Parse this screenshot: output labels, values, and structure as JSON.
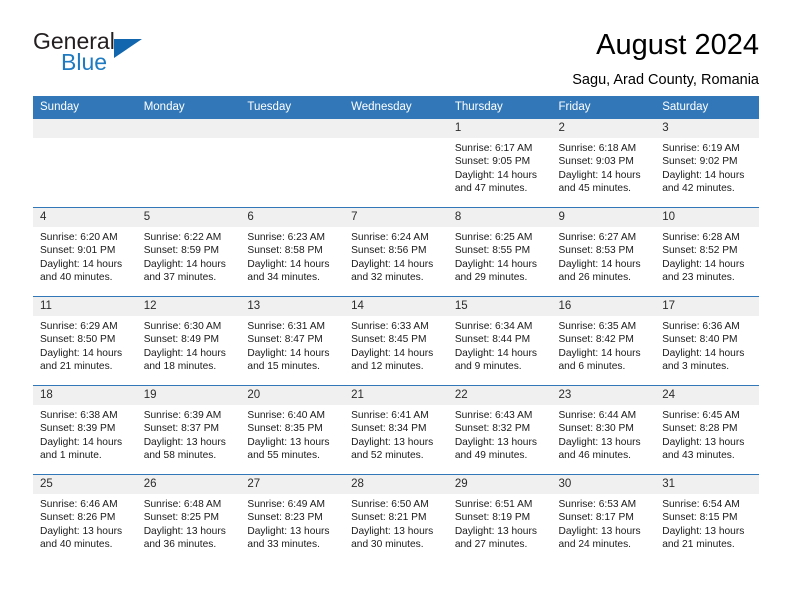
{
  "brand": {
    "name_top": "General",
    "name_bottom": "Blue",
    "accent_color": "#1266ad",
    "logo_text_color": "#231f20"
  },
  "header": {
    "title": "August 2024",
    "subtitle": "Sagu, Arad County, Romania"
  },
  "theme": {
    "header_row_bg": "#3278b9",
    "header_row_text": "#ffffff",
    "daynum_bg": "#f0f0f0"
  },
  "labels": {
    "sunrise_prefix": "Sunrise:",
    "sunset_prefix": "Sunset:",
    "daylight_prefix": "Daylight:"
  },
  "weekdays": [
    "Sunday",
    "Monday",
    "Tuesday",
    "Wednesday",
    "Thursday",
    "Friday",
    "Saturday"
  ],
  "weeks": [
    [
      {
        "day": "",
        "blank": true
      },
      {
        "day": "",
        "blank": true
      },
      {
        "day": "",
        "blank": true
      },
      {
        "day": "",
        "blank": true
      },
      {
        "day": "1",
        "sunrise": "Sunrise: 6:17 AM",
        "sunset": "Sunset: 9:05 PM",
        "daylight_1": "Daylight: 14 hours",
        "daylight_2": "and 47 minutes."
      },
      {
        "day": "2",
        "sunrise": "Sunrise: 6:18 AM",
        "sunset": "Sunset: 9:03 PM",
        "daylight_1": "Daylight: 14 hours",
        "daylight_2": "and 45 minutes."
      },
      {
        "day": "3",
        "sunrise": "Sunrise: 6:19 AM",
        "sunset": "Sunset: 9:02 PM",
        "daylight_1": "Daylight: 14 hours",
        "daylight_2": "and 42 minutes."
      }
    ],
    [
      {
        "day": "4",
        "sunrise": "Sunrise: 6:20 AM",
        "sunset": "Sunset: 9:01 PM",
        "daylight_1": "Daylight: 14 hours",
        "daylight_2": "and 40 minutes."
      },
      {
        "day": "5",
        "sunrise": "Sunrise: 6:22 AM",
        "sunset": "Sunset: 8:59 PM",
        "daylight_1": "Daylight: 14 hours",
        "daylight_2": "and 37 minutes."
      },
      {
        "day": "6",
        "sunrise": "Sunrise: 6:23 AM",
        "sunset": "Sunset: 8:58 PM",
        "daylight_1": "Daylight: 14 hours",
        "daylight_2": "and 34 minutes."
      },
      {
        "day": "7",
        "sunrise": "Sunrise: 6:24 AM",
        "sunset": "Sunset: 8:56 PM",
        "daylight_1": "Daylight: 14 hours",
        "daylight_2": "and 32 minutes."
      },
      {
        "day": "8",
        "sunrise": "Sunrise: 6:25 AM",
        "sunset": "Sunset: 8:55 PM",
        "daylight_1": "Daylight: 14 hours",
        "daylight_2": "and 29 minutes."
      },
      {
        "day": "9",
        "sunrise": "Sunrise: 6:27 AM",
        "sunset": "Sunset: 8:53 PM",
        "daylight_1": "Daylight: 14 hours",
        "daylight_2": "and 26 minutes."
      },
      {
        "day": "10",
        "sunrise": "Sunrise: 6:28 AM",
        "sunset": "Sunset: 8:52 PM",
        "daylight_1": "Daylight: 14 hours",
        "daylight_2": "and 23 minutes."
      }
    ],
    [
      {
        "day": "11",
        "sunrise": "Sunrise: 6:29 AM",
        "sunset": "Sunset: 8:50 PM",
        "daylight_1": "Daylight: 14 hours",
        "daylight_2": "and 21 minutes."
      },
      {
        "day": "12",
        "sunrise": "Sunrise: 6:30 AM",
        "sunset": "Sunset: 8:49 PM",
        "daylight_1": "Daylight: 14 hours",
        "daylight_2": "and 18 minutes."
      },
      {
        "day": "13",
        "sunrise": "Sunrise: 6:31 AM",
        "sunset": "Sunset: 8:47 PM",
        "daylight_1": "Daylight: 14 hours",
        "daylight_2": "and 15 minutes."
      },
      {
        "day": "14",
        "sunrise": "Sunrise: 6:33 AM",
        "sunset": "Sunset: 8:45 PM",
        "daylight_1": "Daylight: 14 hours",
        "daylight_2": "and 12 minutes."
      },
      {
        "day": "15",
        "sunrise": "Sunrise: 6:34 AM",
        "sunset": "Sunset: 8:44 PM",
        "daylight_1": "Daylight: 14 hours",
        "daylight_2": "and 9 minutes."
      },
      {
        "day": "16",
        "sunrise": "Sunrise: 6:35 AM",
        "sunset": "Sunset: 8:42 PM",
        "daylight_1": "Daylight: 14 hours",
        "daylight_2": "and 6 minutes."
      },
      {
        "day": "17",
        "sunrise": "Sunrise: 6:36 AM",
        "sunset": "Sunset: 8:40 PM",
        "daylight_1": "Daylight: 14 hours",
        "daylight_2": "and 3 minutes."
      }
    ],
    [
      {
        "day": "18",
        "sunrise": "Sunrise: 6:38 AM",
        "sunset": "Sunset: 8:39 PM",
        "daylight_1": "Daylight: 14 hours",
        "daylight_2": "and 1 minute."
      },
      {
        "day": "19",
        "sunrise": "Sunrise: 6:39 AM",
        "sunset": "Sunset: 8:37 PM",
        "daylight_1": "Daylight: 13 hours",
        "daylight_2": "and 58 minutes."
      },
      {
        "day": "20",
        "sunrise": "Sunrise: 6:40 AM",
        "sunset": "Sunset: 8:35 PM",
        "daylight_1": "Daylight: 13 hours",
        "daylight_2": "and 55 minutes."
      },
      {
        "day": "21",
        "sunrise": "Sunrise: 6:41 AM",
        "sunset": "Sunset: 8:34 PM",
        "daylight_1": "Daylight: 13 hours",
        "daylight_2": "and 52 minutes."
      },
      {
        "day": "22",
        "sunrise": "Sunrise: 6:43 AM",
        "sunset": "Sunset: 8:32 PM",
        "daylight_1": "Daylight: 13 hours",
        "daylight_2": "and 49 minutes."
      },
      {
        "day": "23",
        "sunrise": "Sunrise: 6:44 AM",
        "sunset": "Sunset: 8:30 PM",
        "daylight_1": "Daylight: 13 hours",
        "daylight_2": "and 46 minutes."
      },
      {
        "day": "24",
        "sunrise": "Sunrise: 6:45 AM",
        "sunset": "Sunset: 8:28 PM",
        "daylight_1": "Daylight: 13 hours",
        "daylight_2": "and 43 minutes."
      }
    ],
    [
      {
        "day": "25",
        "sunrise": "Sunrise: 6:46 AM",
        "sunset": "Sunset: 8:26 PM",
        "daylight_1": "Daylight: 13 hours",
        "daylight_2": "and 40 minutes."
      },
      {
        "day": "26",
        "sunrise": "Sunrise: 6:48 AM",
        "sunset": "Sunset: 8:25 PM",
        "daylight_1": "Daylight: 13 hours",
        "daylight_2": "and 36 minutes."
      },
      {
        "day": "27",
        "sunrise": "Sunrise: 6:49 AM",
        "sunset": "Sunset: 8:23 PM",
        "daylight_1": "Daylight: 13 hours",
        "daylight_2": "and 33 minutes."
      },
      {
        "day": "28",
        "sunrise": "Sunrise: 6:50 AM",
        "sunset": "Sunset: 8:21 PM",
        "daylight_1": "Daylight: 13 hours",
        "daylight_2": "and 30 minutes."
      },
      {
        "day": "29",
        "sunrise": "Sunrise: 6:51 AM",
        "sunset": "Sunset: 8:19 PM",
        "daylight_1": "Daylight: 13 hours",
        "daylight_2": "and 27 minutes."
      },
      {
        "day": "30",
        "sunrise": "Sunrise: 6:53 AM",
        "sunset": "Sunset: 8:17 PM",
        "daylight_1": "Daylight: 13 hours",
        "daylight_2": "and 24 minutes."
      },
      {
        "day": "31",
        "sunrise": "Sunrise: 6:54 AM",
        "sunset": "Sunset: 8:15 PM",
        "daylight_1": "Daylight: 13 hours",
        "daylight_2": "and 21 minutes."
      }
    ]
  ]
}
